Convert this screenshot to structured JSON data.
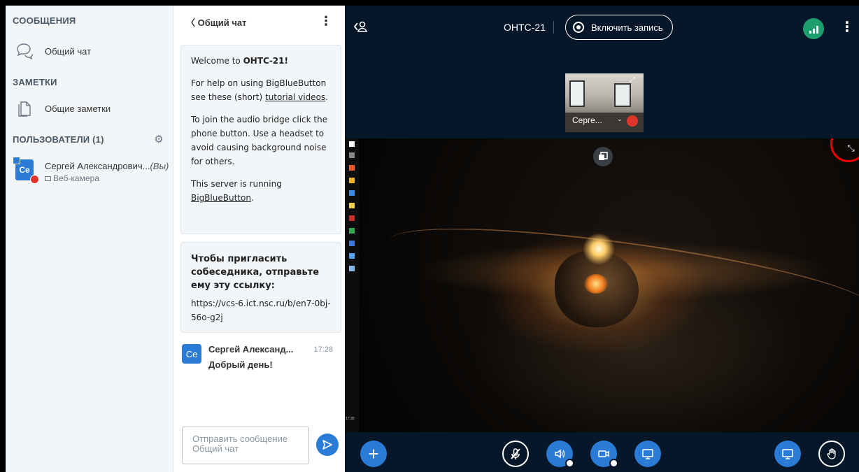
{
  "userlist": {
    "messages_title": "СООБЩЕНИЯ",
    "public_chat": "Общий чат",
    "notes_title": "ЗАМЕТКИ",
    "shared_notes": "Общие заметки",
    "users_title": "ПОЛЬЗОВАТЕЛИ (1)",
    "user": {
      "initials": "Ce",
      "name": "Сергей Александрович...",
      "you": "(Вы)",
      "sub": "Веб-камера"
    }
  },
  "chat": {
    "back_label": "〈 Общий чат",
    "kebab": "⋮",
    "welcome": {
      "line1_prefix": "Welcome to ",
      "brand": "ОНТС",
      "line1_suffix": "-21!",
      "help_text": "For help on using BigBlueButton see these (short) ",
      "help_link": "tutorial videos",
      "help_end": ".",
      "audio_text": "To join the audio bridge click the phone button. Use a headset to avoid causing background noise for others.",
      "server_text": "This server is running ",
      "server_link": "BigBlueButton",
      "server_end": "."
    },
    "invite": {
      "text": "Чтобы пригласить собеседника, отправьте ему эту ссылку:",
      "url": "https://vcs-6.ict.nsc.ru/b/en7-0bj-56o-g2j"
    },
    "message": {
      "avatar": "Ce",
      "sender": "Сергей Александ...",
      "time": "17:28",
      "text": "Добрый день!"
    },
    "input_placeholder_1": "Отправить сообщение",
    "input_placeholder_2": "Общий чат"
  },
  "topbar": {
    "meeting_title": "ОНТС-21",
    "record_label": "Включить запись",
    "options": "⋮"
  },
  "webcam": {
    "name": "Серге...",
    "chevron": "⌄"
  },
  "taskbar_clock": "17:30",
  "colors": {
    "accent": "#2a7bd5",
    "dark_bg": "#06172a",
    "connection_ok": "#1d9e6e",
    "muted_red": "#e0352b"
  }
}
